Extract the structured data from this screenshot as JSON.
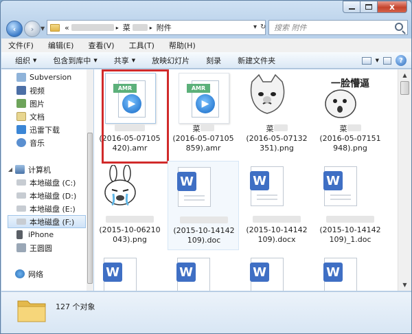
{
  "window": {
    "caption": {
      "close": "x"
    }
  },
  "address": {
    "prefix": "«",
    "sep1": "▸",
    "crumb_partial": "菜",
    "sep2": "▸",
    "folder": "附件",
    "dropdown": "▾",
    "refresh": "↻"
  },
  "search": {
    "placeholder": "搜索 附件"
  },
  "menu": {
    "items": [
      "文件(F)",
      "编辑(E)",
      "查看(V)",
      "工具(T)",
      "帮助(H)"
    ]
  },
  "toolbar": {
    "organize": "组织",
    "include_library": "包含到库中",
    "share": "共享",
    "slideshow": "放映幻灯片",
    "burn": "刻录",
    "new_folder": "新建文件夹",
    "dropdown_arrow": "▼",
    "help": "?"
  },
  "nav": {
    "favorites": [
      "Subversion",
      "视频",
      "图片",
      "文档",
      "迅雷下载",
      "音乐"
    ],
    "computer": "计算机",
    "drives": [
      "本地磁盘 (C:)",
      "本地磁盘 (D:)",
      "本地磁盘 (E:)",
      "本地磁盘 (F:)"
    ],
    "iphone": "iPhone",
    "user": "王圆圆",
    "network": "网络"
  },
  "files": [
    {
      "line1": "",
      "line2": "(2016-05-07105",
      "line3": "420).amr",
      "type": "amr"
    },
    {
      "line1": "菜",
      "line2": "(2016-05-07105",
      "line3": "859).amr",
      "type": "amr"
    },
    {
      "line1": "菜",
      "line2": "(2016-05-07132",
      "line3": "351).png",
      "type": "png-cat"
    },
    {
      "line1": "菜",
      "line2": "(2016-05-07151",
      "line3": "948).png",
      "type": "png-meme",
      "meme_text": "一脸懵逼"
    },
    {
      "line1": "",
      "line2": "(2015-10-06210",
      "line3": "043).png",
      "type": "png-rabbit"
    },
    {
      "line1": "",
      "line2": "(2015-10-14142",
      "line3": "109).doc",
      "type": "doc"
    },
    {
      "line1": "",
      "line2": "(2015-10-14142",
      "line3": "109).docx",
      "type": "doc"
    },
    {
      "line1": "",
      "line2": "(2015-10-14142",
      "line3": "109)_1.doc",
      "type": "doc"
    }
  ],
  "wps_letter": "W",
  "amr_label": "AMR",
  "status": {
    "count": "127 个对象"
  },
  "colors": {
    "highlight_frame": "#d12a2a",
    "wps_blue": "#3f6fc4"
  }
}
